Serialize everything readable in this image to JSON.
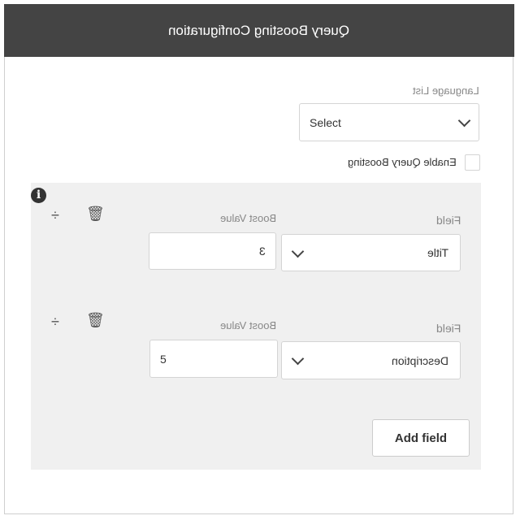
{
  "header": {
    "title": "Query Boosting Configuration"
  },
  "language": {
    "label": "Language List",
    "value": "Select"
  },
  "enable": {
    "label": "Enable Query Boosting",
    "checked": false
  },
  "rows": [
    {
      "field_label": "Field",
      "field_value": "Title",
      "boost_label": "Boost Value",
      "boost_value": "3"
    },
    {
      "field_label": "Field",
      "field_value": "Description",
      "boost_label": "Boost Value",
      "boost_value": "5"
    }
  ],
  "add_field": "Add field",
  "icons": {
    "info": "info-icon",
    "move": "move-icon",
    "delete": "trash-icon",
    "dropdown": "chevron-down-icon"
  }
}
